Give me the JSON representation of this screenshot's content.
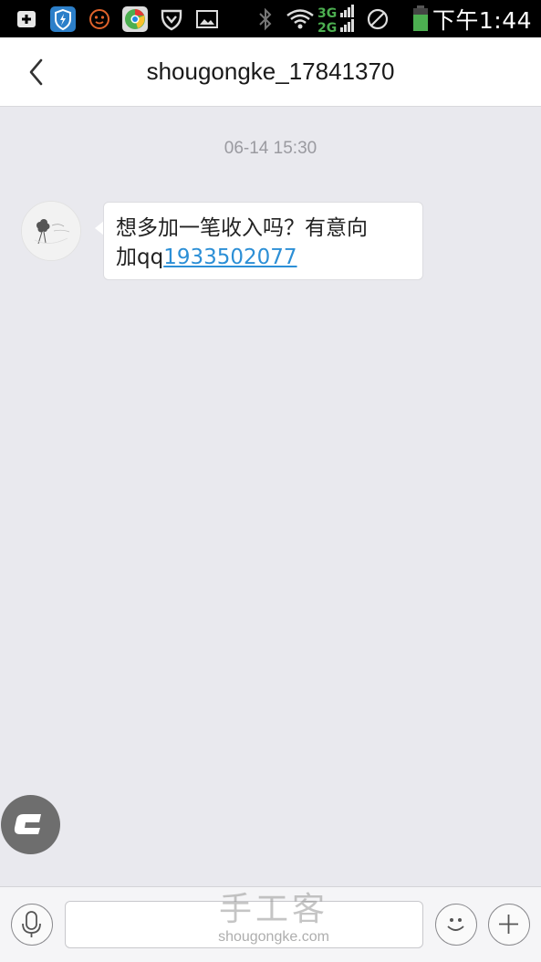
{
  "status_bar": {
    "network": "3G 2G",
    "time": "下午1:44",
    "icons": [
      "add-box-icon",
      "shield-app-icon",
      "face-icon",
      "chrome-icon",
      "vpn-icon",
      "image-icon",
      "bluetooth-icon",
      "wifi-icon",
      "network-signal-icon",
      "no-sim-icon",
      "battery-icon"
    ]
  },
  "header": {
    "title": "shougongke_17841370",
    "back_icon": "chevron-left-icon"
  },
  "chat": {
    "timestamp": "06-14 15:30",
    "message": {
      "text_line1": "想多加一笔收入吗？有意向",
      "text_prefix": "加qq",
      "link": "1933502077"
    }
  },
  "floating_button": {
    "icon": "c-logo-icon"
  },
  "input_bar": {
    "voice_icon": "microphone-icon",
    "emoji_icon": "smiley-icon",
    "add_icon": "plus-icon",
    "input_value": "",
    "watermark_cn": "手工客",
    "watermark_en": "shougongke.com"
  },
  "colors": {
    "background": "#e9e9ee",
    "link": "#2c8fd6",
    "header_bg": "#ffffff",
    "status_bg": "#000000"
  }
}
